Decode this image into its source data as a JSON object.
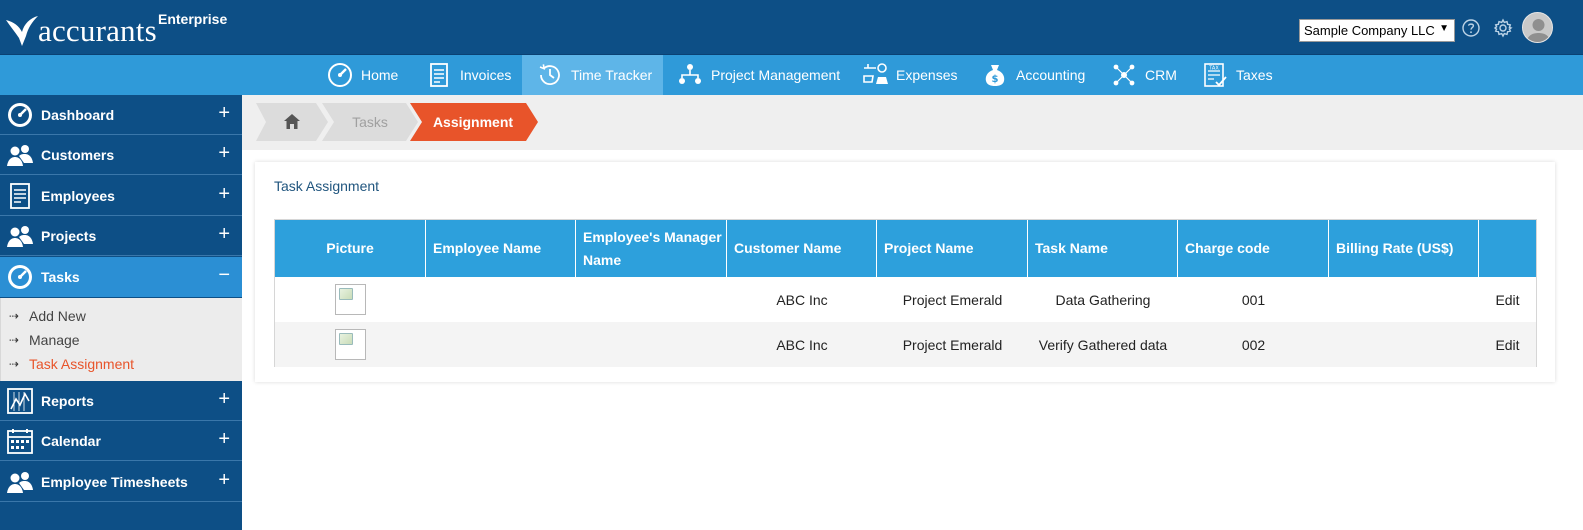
{
  "header": {
    "logo_text": "accurants",
    "edition": "Enterprise",
    "company": "Sample Company LLC",
    "company_caret": "▼",
    "icons": [
      "help-icon",
      "settings-icon",
      "user-avatar-icon"
    ]
  },
  "mainnav": {
    "items": [
      {
        "label": "Home",
        "icon": "speedometer-icon"
      },
      {
        "label": "Invoices",
        "icon": "document-icon"
      },
      {
        "label": "Time Tracker",
        "icon": "clock-history-icon"
      },
      {
        "label": "Project Management",
        "icon": "org-chart-icon"
      },
      {
        "label": "Expenses",
        "icon": "expenses-icon"
      },
      {
        "label": "Accounting",
        "icon": "money-bag-icon"
      },
      {
        "label": "CRM",
        "icon": "network-people-icon"
      },
      {
        "label": "Taxes",
        "icon": "tax-form-icon"
      }
    ],
    "active_index": 2
  },
  "sidebar": {
    "items": [
      {
        "label": "Dashboard",
        "icon": "speedometer-icon",
        "toggle": "+"
      },
      {
        "label": "Customers",
        "icon": "people-icon",
        "toggle": "+"
      },
      {
        "label": "Employees",
        "icon": "document-icon",
        "toggle": "+"
      },
      {
        "label": "Projects",
        "icon": "people-icon",
        "toggle": "+"
      },
      {
        "label": "Tasks",
        "icon": "speedometer-icon",
        "toggle": "−"
      },
      {
        "label": "Reports",
        "icon": "chart-icon",
        "toggle": "+"
      },
      {
        "label": "Calendar",
        "icon": "calendar-icon",
        "toggle": "+"
      },
      {
        "label": "Employee Timesheets",
        "icon": "people-icon",
        "toggle": "+"
      }
    ],
    "active_index": 4,
    "submenu": [
      {
        "label": "Add New",
        "current": false
      },
      {
        "label": "Manage",
        "current": false
      },
      {
        "label": "Task Assignment",
        "current": true
      }
    ],
    "submenu_arrow": "⇢"
  },
  "breadcrumb": {
    "home_icon": "home-icon",
    "items": [
      "Tasks",
      "Assignment"
    ],
    "colors": {
      "inactive": "#dcdcdc",
      "active": "#e8542a"
    }
  },
  "card": {
    "title": "Task Assignment",
    "columns": [
      "Picture",
      "Employee Name",
      "Employee's Manager Name",
      "Customer Name",
      "Project Name",
      "Task Name",
      "Charge code",
      "Billing Rate (US$)",
      ""
    ],
    "rows": [
      {
        "employee": "",
        "manager": "",
        "customer": "ABC Inc",
        "project": "Project Emerald",
        "task": "Data Gathering",
        "charge_code": "001",
        "billing_rate": "",
        "action": "Edit"
      },
      {
        "employee": "",
        "manager": "",
        "customer": "ABC Inc",
        "project": "Project Emerald",
        "task": "Verify Gathered data",
        "charge_code": "002",
        "billing_rate": "",
        "action": "Edit"
      }
    ]
  },
  "colors": {
    "header_bg": "#0d4f86",
    "nav_bg": "#2f9ad9",
    "table_header_bg": "#2da0dc",
    "accent": "#e8542a"
  }
}
